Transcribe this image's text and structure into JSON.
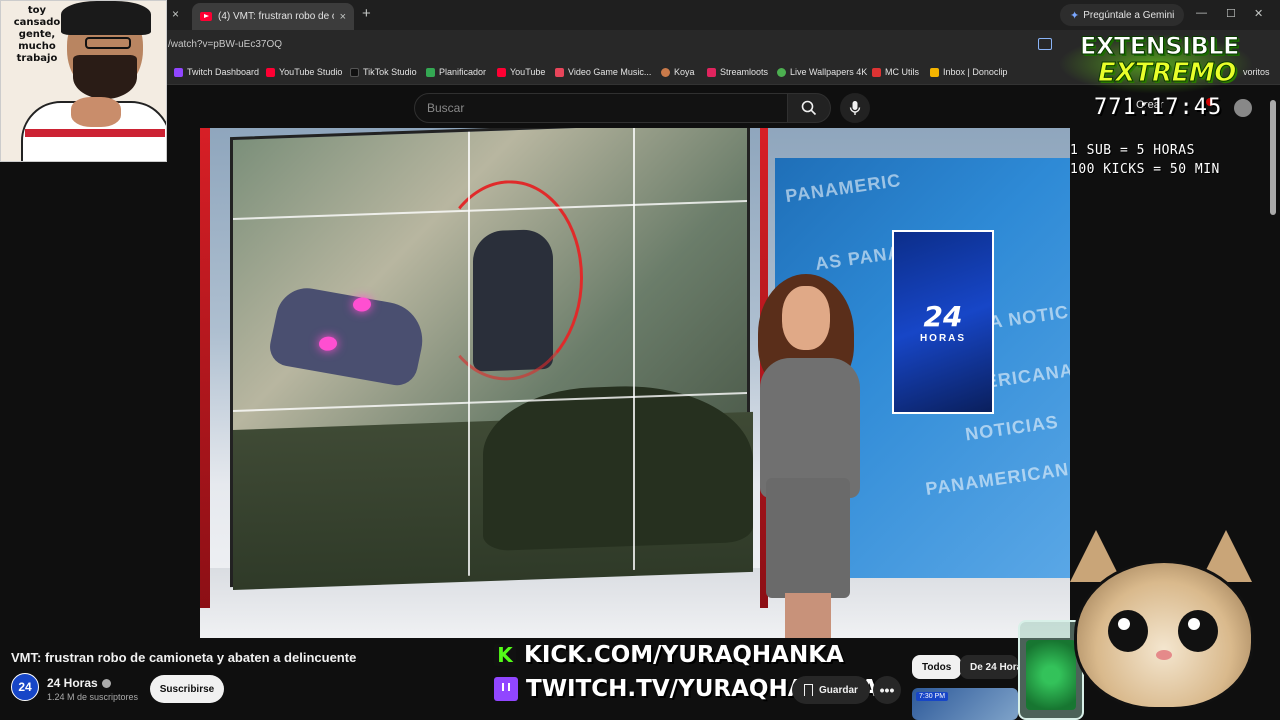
{
  "browser": {
    "tab_title": "(4) VMT: frustran robo de c",
    "url": "/watch?v=pBW-uEc37OQ",
    "gemini_label": "Pregúntale a Gemini",
    "new_tab_icon": "+",
    "close_icon": "×",
    "bookmarks": [
      {
        "label": "Twitch Dashboard",
        "color": "#9146ff"
      },
      {
        "label": "YouTube Studio",
        "color": "#ff0033"
      },
      {
        "label": "TikTok Studio",
        "color": "#111111"
      },
      {
        "label": "Planificador",
        "color": "#34a853"
      },
      {
        "label": "YouTube",
        "color": "#ff0033"
      },
      {
        "label": "Video Game Music...",
        "color": "#e8455a"
      },
      {
        "label": "Koya",
        "color": "#c97a4a"
      },
      {
        "label": "Streamloots",
        "color": "#e0245e"
      },
      {
        "label": "Live Wallpapers 4K",
        "color": "#4caf50"
      },
      {
        "label": "MC Utils",
        "color": "#d33"
      },
      {
        "label": "Inbox | Donoclip",
        "color": "#f4b400"
      }
    ],
    "bookmarks_overflow": "voritos"
  },
  "youtube": {
    "search_placeholder": "Buscar",
    "create_label": "Crear",
    "video_title": "VMT: frustran robo de camioneta y abaten a delincuente",
    "channel_name": "24 Horas",
    "channel_avatar_text": "24",
    "subscribers": "1.24 M de suscriptores",
    "subscribe_label": "Suscribirse",
    "save_label": "Guardar",
    "more_label": "•••",
    "chips": [
      "Todos",
      "De 24 Horas"
    ],
    "thumb_time": "7:30 PM"
  },
  "broadcast": {
    "logo_number": "24",
    "logo_sub": "HORAS",
    "wall_texts": [
      "PANAMERIC",
      "AS PANA",
      "NA NOTIC",
      "AMERICANA",
      "NOTICIAS",
      "PANAMERICANA"
    ]
  },
  "overlay": {
    "webcam_caption": "toy cansado gente, mucho trabajo",
    "logo_line1": "EXTENSIBLE",
    "logo_line2": "EXTREMO",
    "timer": "771:17:45",
    "rule1": "1 SUB = 5 HORAS",
    "rule2": "100 KICKS = 50 MIN",
    "kick_url": "KICK.COM/YURAQHANKA",
    "twitch_url": "TWITCH.TV/YURAQHANKAA",
    "kick_icon_letter": "K"
  },
  "colors": {
    "youtube_red": "#ff0033",
    "kick_green": "#53fc18",
    "twitch_purple": "#9146ff",
    "logo_green": "#e9ff2a"
  }
}
